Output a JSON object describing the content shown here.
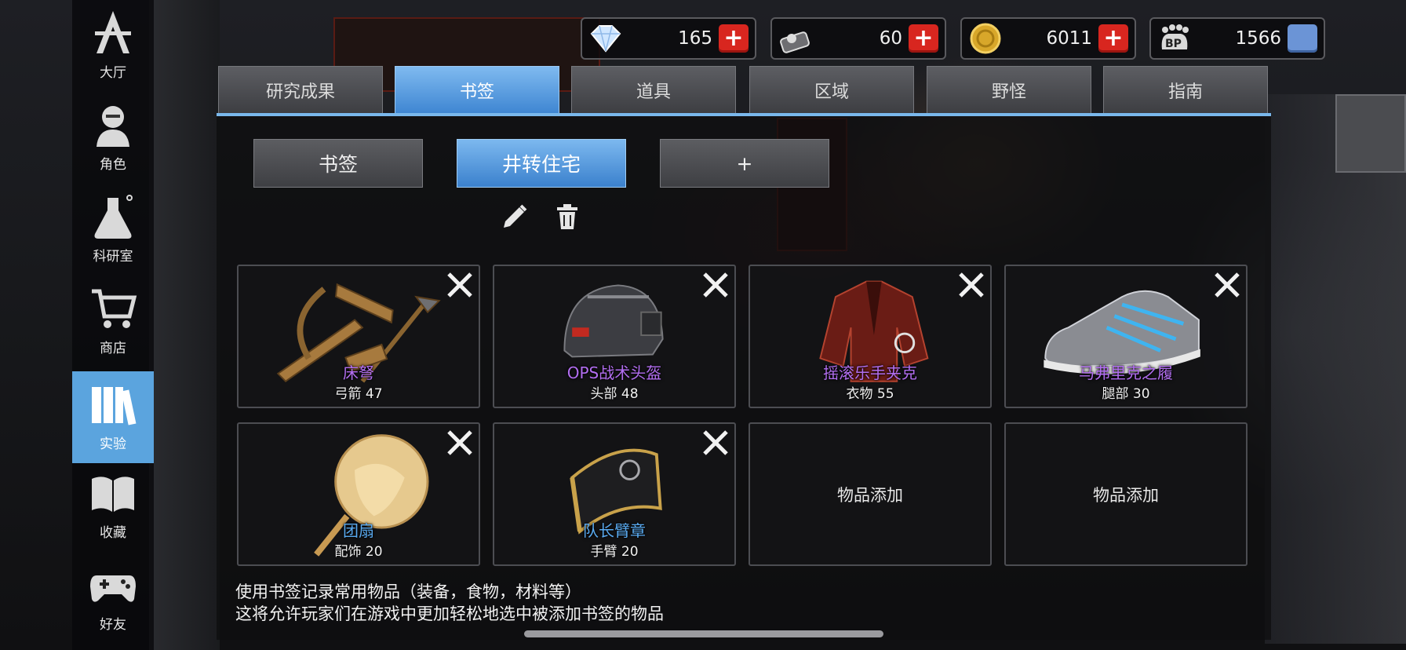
{
  "sidebar": {
    "items": [
      {
        "label": "大厅",
        "icon": "lobby-logo-icon"
      },
      {
        "label": "角色",
        "icon": "character-icon"
      },
      {
        "label": "科研室",
        "icon": "flask-icon"
      },
      {
        "label": "商店",
        "icon": "cart-icon"
      },
      {
        "label": "实验",
        "icon": "books-icon",
        "active": true
      },
      {
        "label": "收藏",
        "icon": "open-book-icon"
      },
      {
        "label": "好友",
        "icon": "gamepad-icon"
      }
    ]
  },
  "currency": [
    {
      "value": "165",
      "icon": "diamond-icon"
    },
    {
      "value": "60",
      "icon": "scanner-icon"
    },
    {
      "value": "6011",
      "icon": "gold-coin-icon"
    },
    {
      "value": "1566",
      "icon": "bp-paw-icon"
    }
  ],
  "tabs": [
    {
      "label": "研究成果"
    },
    {
      "label": "书签",
      "active": true
    },
    {
      "label": "道具"
    },
    {
      "label": "区域"
    },
    {
      "label": "野怪"
    },
    {
      "label": "指南"
    }
  ],
  "bookmarks": [
    {
      "label": "书签"
    },
    {
      "label": "井转住宅",
      "active": true
    },
    {
      "label": "+"
    }
  ],
  "items": [
    {
      "name": "床弩",
      "sub": "弓箭 47",
      "color": "#b26ef0",
      "art": "crossbow"
    },
    {
      "name": "OPS战术头盔",
      "sub": "头部 48",
      "color": "#b26ef0",
      "art": "helmet"
    },
    {
      "name": "摇滚乐手夹克",
      "sub": "衣物 55",
      "color": "#b26ef0",
      "art": "jacket"
    },
    {
      "name": "马弗里克之履",
      "sub": "腿部 30",
      "color": "#b26ef0",
      "art": "shoe"
    },
    {
      "name": "团扇",
      "sub": "配饰 20",
      "color": "#5aaaf0",
      "art": "fan"
    },
    {
      "name": "队长臂章",
      "sub": "手臂 20",
      "color": "#5aaaf0",
      "art": "armband"
    }
  ],
  "empty_slot_label": "物品添加",
  "hint": {
    "line1": "使用书签记录常用物品（装备，食物，材料等）",
    "line2": "这将允许玩家们在游戏中更加轻松地选中被添加书签的物品"
  }
}
